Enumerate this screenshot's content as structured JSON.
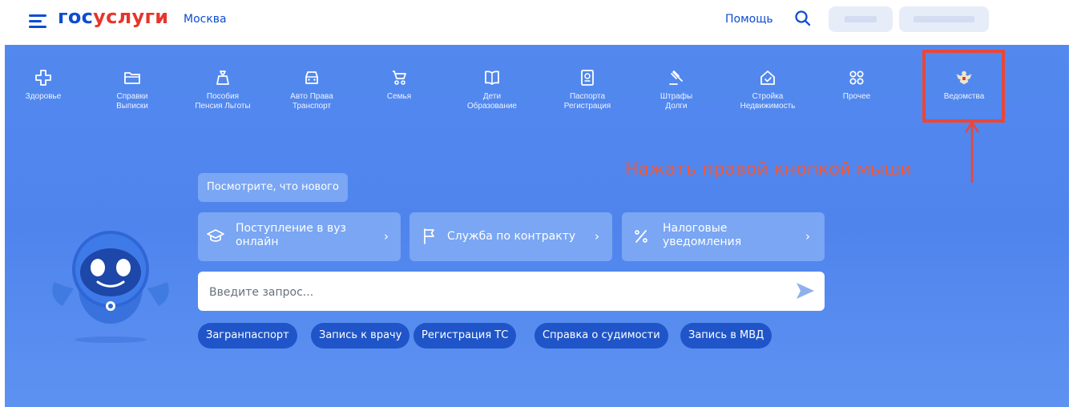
{
  "header": {
    "logo_part1": "гос",
    "logo_part2": "услуги",
    "city": "Москва",
    "help": "Помощь",
    "icons": [
      "menu-icon",
      "search-icon"
    ],
    "brand_colors": {
      "blue": "#0d4cd3",
      "red": "#e7352b"
    }
  },
  "categories": [
    {
      "label": "Здоровье",
      "icon": "health-cross-icon"
    },
    {
      "label": "Справки\nВыписки",
      "icon": "folder-icon"
    },
    {
      "label": "Пособия\nПенсия Льготы",
      "icon": "money-bag-icon"
    },
    {
      "label": "Авто Права\nТранспорт",
      "icon": "car-icon"
    },
    {
      "label": "Семья",
      "icon": "stroller-icon"
    },
    {
      "label": "Дети\nОбразование",
      "icon": "book-icon"
    },
    {
      "label": "Паспорта\nРегистрация",
      "icon": "passport-icon"
    },
    {
      "label": "Штрафы\nДолги",
      "icon": "gavel-icon"
    },
    {
      "label": "Стройка\nНедвижимость",
      "icon": "house-icon"
    },
    {
      "label": "Прочее",
      "icon": "grid-icon"
    },
    {
      "label": "Ведомства",
      "icon": "coat-of-arms-icon"
    }
  ],
  "annotation": {
    "text": "Нажать правой кнопкой мыши",
    "color": "#e8473a"
  },
  "whats_new": "Посмотрите, что нового",
  "popular": [
    {
      "label": "Поступление в вуз\nонлайн",
      "icon": "graduation-cap-icon"
    },
    {
      "label": "Служба по контракту",
      "icon": "flag-icon"
    },
    {
      "label": "Налоговые\nуведомления",
      "icon": "percent-icon"
    }
  ],
  "chevron": "›",
  "search": {
    "placeholder": "Введите запрос...",
    "value": ""
  },
  "quick_links": [
    "Загранпаспорт",
    "Запись к врачу",
    "Регистрация ТС",
    "Справка о судимости",
    "Запись в МВД"
  ],
  "colors": {
    "banner": "#5289ee",
    "card": "#7aa6f3",
    "chip": "#1f55c8"
  }
}
